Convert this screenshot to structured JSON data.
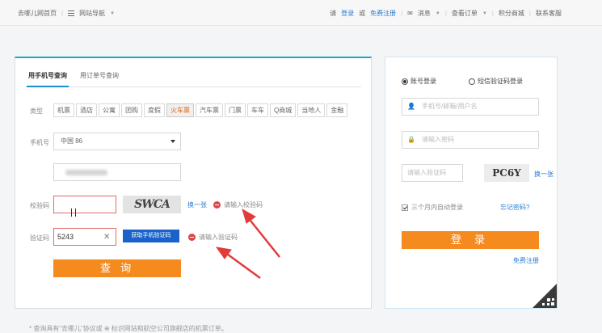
{
  "topbar": {
    "home": "去哪儿网首页",
    "site_nav": "网站导航",
    "please": "请",
    "login": "登录",
    "or": "或",
    "register": "免费注册",
    "messages": "消息",
    "orders": "查看订单",
    "points_mall": "积分商城",
    "contact": "联系客服"
  },
  "query": {
    "tabs": [
      "用手机号查询",
      "用订单号查询"
    ],
    "type_label": "类型",
    "types": [
      "机票",
      "酒店",
      "公寓",
      "团购",
      "度假",
      "火车票",
      "汽车票",
      "门票",
      "车车",
      "Q商城",
      "当地人",
      "金融"
    ],
    "active_type": "火车票",
    "phone_label": "手机号",
    "country": "中国 86",
    "captcha_label": "校验码",
    "captcha_text": "SWCA",
    "refresh": "换一张",
    "captcha_error": "请输入校验码",
    "sms_label": "验证码",
    "sms_value": "5243",
    "sms_button": "获取手机验证码",
    "sms_error": "请输入验证码",
    "submit": "查 询"
  },
  "note": "* 查询具有“去哪儿”协议或 ⊕ 标识网站和航空公司旗舰店的机票订单。",
  "login": {
    "mode_account": "账号登录",
    "mode_sms": "短信验证码登录",
    "username_placeholder": "手机号/邮箱/用户名",
    "password_placeholder": "请输入密码",
    "verify_placeholder": "请输入验证码",
    "captcha_text": "PC6Y",
    "refresh": "换一张",
    "auto_login": "三个月内自动登录",
    "forgot": "忘记密码?",
    "submit": "登 录",
    "register": "免费注册"
  },
  "colors": {
    "accent_orange": "#f58a1f",
    "link_blue": "#2a7bd1",
    "error_red": "#d94848",
    "annotation_red": "#e23b3b"
  }
}
